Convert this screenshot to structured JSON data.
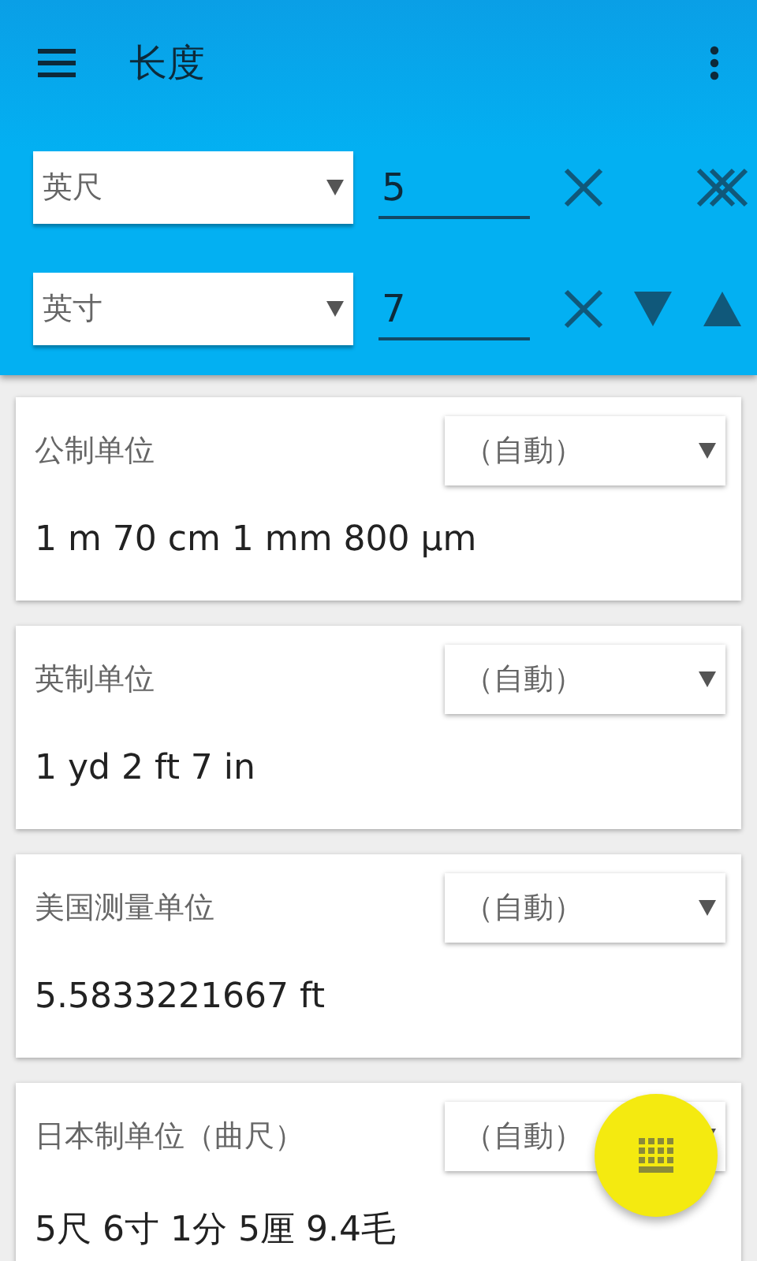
{
  "toolbar": {
    "title": "长度"
  },
  "inputs": [
    {
      "unit": "英尺",
      "value": "5",
      "actions": [
        {
          "kind": "clear"
        },
        {
          "kind": "clear-all"
        }
      ]
    },
    {
      "unit": "英寸",
      "value": "7",
      "actions": [
        {
          "kind": "clear"
        },
        {
          "kind": "down"
        },
        {
          "kind": "up"
        }
      ]
    }
  ],
  "cards": [
    {
      "label": "公制单位",
      "mode": "（自動）",
      "result": "1 m 70 cm 1 mm 800 µm"
    },
    {
      "label": "英制单位",
      "mode": "（自動）",
      "result": "1 yd 2 ft 7 in"
    },
    {
      "label": "美国测量单位",
      "mode": "（自動）",
      "result": "5.5833221667 ft"
    },
    {
      "label": "日本制单位（曲尺）",
      "mode": "（自動）",
      "result": "5尺 6寸 1分 5厘 9.4毛"
    }
  ]
}
